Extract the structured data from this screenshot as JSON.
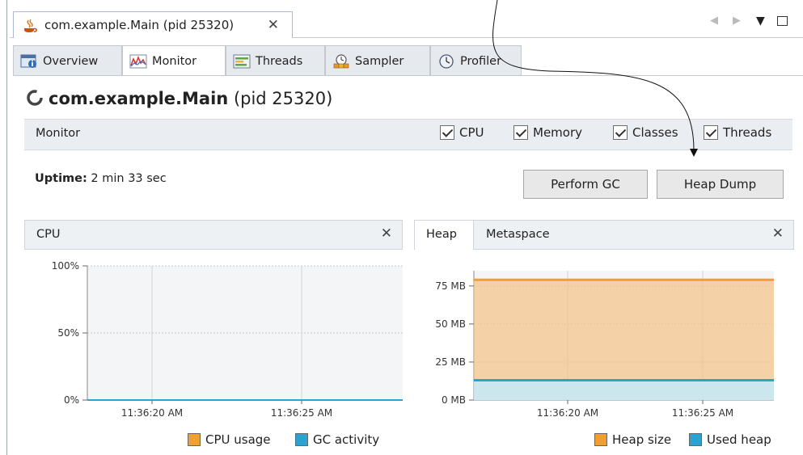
{
  "window": {
    "doc_tab_label": "com.example.Main (pid 25320)",
    "close_glyph": "✕"
  },
  "subtabs": [
    {
      "label": "Overview",
      "icon": "overview-icon"
    },
    {
      "label": "Monitor",
      "icon": "monitor-icon"
    },
    {
      "label": "Threads",
      "icon": "threads-icon"
    },
    {
      "label": "Sampler",
      "icon": "sampler-icon"
    },
    {
      "label": "Profiler",
      "icon": "profiler-icon"
    }
  ],
  "page": {
    "title_main": "com.example.Main",
    "title_pid": "(pid 25320)"
  },
  "monitor": {
    "title": "Monitor",
    "checkboxes": [
      {
        "label": "CPU",
        "checked": true
      },
      {
        "label": "Memory",
        "checked": true
      },
      {
        "label": "Classes",
        "checked": true
      },
      {
        "label": "Threads",
        "checked": true
      }
    ],
    "uptime_label": "Uptime:",
    "uptime_value": "2 min 33 sec",
    "perform_gc": "Perform GC",
    "heap_dump": "Heap Dump"
  },
  "cpu_panel": {
    "title": "CPU",
    "legend": [
      {
        "label": "CPU usage",
        "color": "#f0a030"
      },
      {
        "label": "GC activity",
        "color": "#2aa3d0"
      }
    ]
  },
  "heap_panel": {
    "tab_heap": "Heap",
    "tab_metaspace": "Metaspace",
    "legend": [
      {
        "label": "Heap size",
        "color": "#f0a030"
      },
      {
        "label": "Used heap",
        "color": "#2aa3d0"
      }
    ]
  },
  "chart_data": [
    {
      "type": "line",
      "name": "cpu",
      "y_ticks": [
        "100%",
        "50%",
        "0%"
      ],
      "x_ticks": [
        "11:36:20 AM",
        "11:36:25 AM"
      ],
      "ylim": [
        0,
        100
      ],
      "series": [
        {
          "name": "CPU usage",
          "values": [
            0,
            0
          ]
        },
        {
          "name": "GC activity",
          "values": [
            0,
            0
          ]
        }
      ]
    },
    {
      "type": "area",
      "name": "heap",
      "y_ticks": [
        "75 MB",
        "50 MB",
        "25 MB",
        "0 MB"
      ],
      "x_ticks": [
        "11:36:20 AM",
        "11:36:25 AM"
      ],
      "ylim": [
        0,
        85
      ],
      "series": [
        {
          "name": "Heap size",
          "values": [
            79,
            79
          ]
        },
        {
          "name": "Used heap",
          "values": [
            13,
            13
          ]
        }
      ]
    }
  ]
}
